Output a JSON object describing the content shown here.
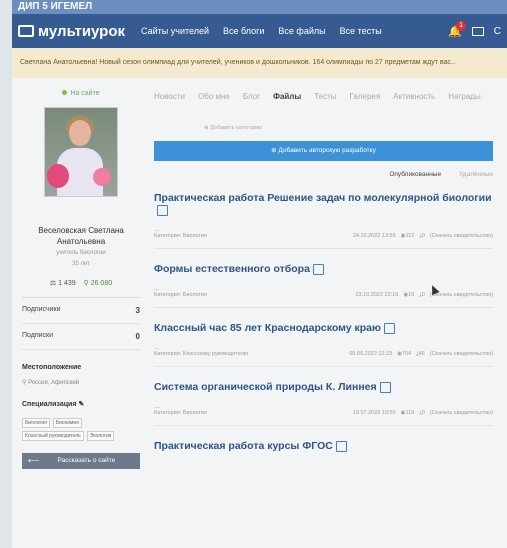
{
  "banner": {
    "text": "ДИП 5 ИГЕМЕЛ"
  },
  "nav": {
    "logo": "мультиурок",
    "links": [
      "Сайты учителей",
      "Все блоги",
      "Все файлы",
      "Все тесты"
    ],
    "notifications_count": "1"
  },
  "notice": {
    "text": "Светлана Анатольевна! Новый сезон олимпиад для учителей, учеников и дошкольников. 164 олимпиады по 27 предметам ждут вас..."
  },
  "profile": {
    "status": "На сайте",
    "name_line1": "Веселовская Светлана",
    "name_line2": "Анатольевна",
    "role": "учитель биологии",
    "role2": "35 лет",
    "stat_views": "1 439",
    "stat_points": "26 080",
    "subscribers_label": "Подписчики",
    "subscribers_value": "3",
    "subscriptions_label": "Подписки",
    "subscriptions_value": "0",
    "location_label": "Местоположение",
    "location_value": "Россия, Афипский",
    "specialization_label": "Специализация",
    "tags": [
      "Биология",
      "Биохимия",
      "Классный руководитель",
      "Экология"
    ],
    "share_label": "Рассказать о сайте"
  },
  "tabs": [
    "Новости",
    "Обо мне",
    "Блог",
    "Файлы",
    "Тесты",
    "Галерея",
    "Активность",
    "Награды"
  ],
  "active_tab": "Файлы",
  "add_category": "Добавить категорию",
  "add_button": "Добавить авторскую разработку",
  "filters": {
    "published": "Опубликованные",
    "deleted": "Удалённые"
  },
  "files": [
    {
      "title": "Практическая работа Решение задач по молекулярной биологии",
      "category": "Категория: Биология",
      "date": "24.10.2022 13:56",
      "views": "112",
      "downloads": "0",
      "cert": "(Скачать свидетельство)"
    },
    {
      "title": "Формы естественного отбора",
      "category": "Категория: Биология",
      "date": "23.10.2022 22:16",
      "views": "16",
      "downloads": "0",
      "cert": "(Скачать свидетельство)"
    },
    {
      "title": "Классный час 85 лет Краснодарскому краю",
      "category": "Категория: Классному руководителю",
      "date": "05.09.2022 12:23",
      "views": "704",
      "downloads": "46",
      "cert": "(Скачать свидетельство)"
    },
    {
      "title": "Система органической природы К. Линнея",
      "category": "Категория: Биология",
      "date": "19.07.2022 19:50",
      "views": "118",
      "downloads": "0",
      "cert": "(Скачать свидетельство)"
    },
    {
      "title": "Практическая работа курсы ФГОС",
      "category": "",
      "date": "",
      "views": "",
      "downloads": "",
      "cert": ""
    }
  ],
  "icons": [
    "book-logo-icon",
    "bell-icon",
    "mail-icon",
    "eye-icon",
    "download-icon",
    "edit-icon",
    "location-icon",
    "share-icon"
  ]
}
